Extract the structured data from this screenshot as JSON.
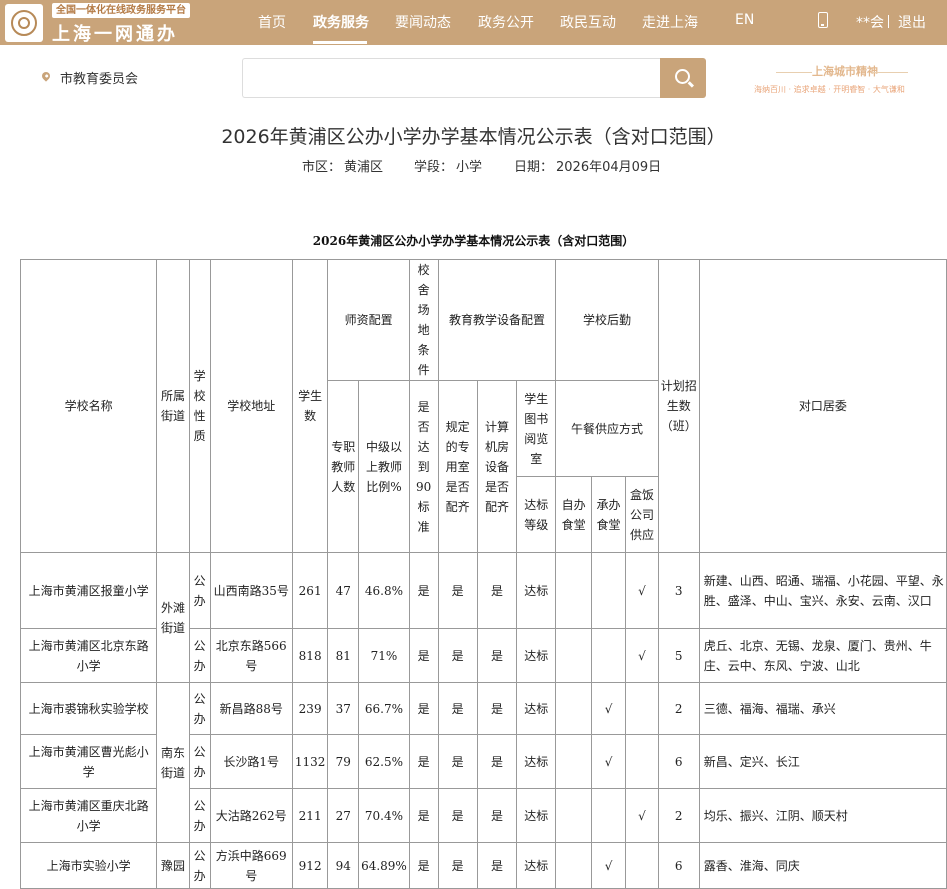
{
  "header": {
    "logo_tag": "全国一体化在线政务服务平台",
    "logo_text": "上海一网通办",
    "nav": [
      "首页",
      "政务服务",
      "要闻动态",
      "政务公开",
      "政民互动",
      "走进上海",
      "EN"
    ],
    "user": "**会",
    "logout": "退出"
  },
  "location": "市教育委员会",
  "search": {
    "placeholder": ""
  },
  "spirit": {
    "title": "上海城市精神",
    "subtitle": "海纳百川 · 追求卓越 · 开明睿智 · 大气谦和"
  },
  "page": {
    "title": "2026年黄浦区公办小学办学基本情况公示表（含对口范围）",
    "district_label": "市区：",
    "district": "黄浦区",
    "stage_label": "学段：",
    "stage": "小学",
    "date_label": "日期：",
    "date": "2026年04月09日"
  },
  "table": {
    "caption": "2026年黄浦区公办小学办学基本情况公示表（含对口范围）",
    "headers": {
      "school_name": "学校名称",
      "street": "所属街道",
      "nature": "学校性质",
      "address": "学校地址",
      "students": "学生数",
      "teachers_group": "师资配置",
      "campus_group": "校舍场地条件",
      "equipment_group": "教育教学设备配置",
      "logistics_group": "学校后勤",
      "plan": "计划招生数（班）",
      "scope": "对口居委",
      "full_time": "专职教师人数",
      "senior_ratio": "中级以上教师比例%",
      "standard90": "是否达到90标准",
      "special_room": "规定的专用室是否配齐",
      "computer": "计算机房设备是否配齐",
      "library": "学生图书阅览室",
      "lunch": "午餐供应方式",
      "library_level": "达标等级",
      "canteen_self": "自办食堂",
      "canteen_contract": "承办食堂",
      "box_lunch": "盒饭公司供应"
    },
    "rows": [
      {
        "name": "上海市黄浦区报童小学",
        "nature": "公办",
        "address": "山西南路35号",
        "students": "261",
        "teachers": "47",
        "ratio": "46.8%",
        "std90": "是",
        "room": "是",
        "computer": "是",
        "library": "达标",
        "self": "",
        "contract": "",
        "box": "√",
        "plan": "3",
        "scope": "新建、山西、昭通、瑞福、小花园、平望、永胜、盛泽、中山、宝兴、永安、云南、汉口"
      },
      {
        "name": "上海市黄浦区北京东路小学",
        "nature": "公办",
        "address": "北京东路566号",
        "students": "818",
        "teachers": "81",
        "ratio": "71%",
        "std90": "是",
        "room": "是",
        "computer": "是",
        "library": "达标",
        "self": "",
        "contract": "",
        "box": "√",
        "plan": "5",
        "scope": "虎丘、北京、无锡、龙泉、厦门、贵州、牛庄、云中、东风、宁波、山北"
      },
      {
        "name": "上海市裘锦秋实验学校",
        "nature": "公办",
        "address": "新昌路88号",
        "students": "239",
        "teachers": "37",
        "ratio": "66.7%",
        "std90": "是",
        "room": "是",
        "computer": "是",
        "library": "达标",
        "self": "",
        "contract": "√",
        "box": "",
        "plan": "2",
        "scope": "三德、福海、福瑞、承兴"
      },
      {
        "name": "上海市黄浦区曹光彪小学",
        "nature": "公办",
        "address": "长沙路1号",
        "students": "1132",
        "teachers": "79",
        "ratio": "62.5%",
        "std90": "是",
        "room": "是",
        "computer": "是",
        "library": "达标",
        "self": "",
        "contract": "√",
        "box": "",
        "plan": "6",
        "scope": "新昌、定兴、长江"
      },
      {
        "name": "上海市黄浦区重庆北路小学",
        "nature": "公办",
        "address": "大沽路262号",
        "students": "211",
        "teachers": "27",
        "ratio": "70.4%",
        "std90": "是",
        "room": "是",
        "computer": "是",
        "library": "达标",
        "self": "",
        "contract": "",
        "box": "√",
        "plan": "2",
        "scope": "均乐、振兴、江阴、顺天村"
      },
      {
        "name": "上海市实验小学",
        "nature": "公办",
        "address": "方浜中路669号",
        "students": "912",
        "teachers": "94",
        "ratio": "64.89%",
        "std90": "是",
        "room": "是",
        "computer": "是",
        "library": "达标",
        "self": "",
        "contract": "√",
        "box": "",
        "plan": "6",
        "scope": "露香、淮海、同庆"
      }
    ],
    "streets": [
      "外滩街道",
      "南东街道",
      "豫园"
    ]
  }
}
